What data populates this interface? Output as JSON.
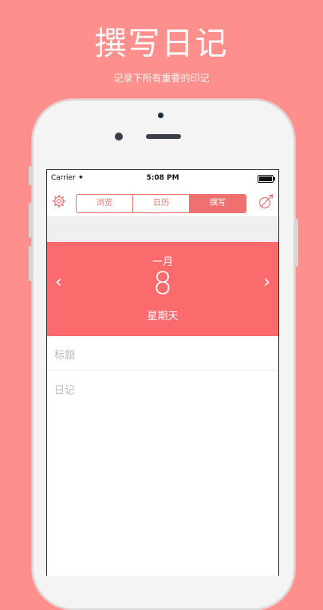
{
  "promo": {
    "title": "撰写日记",
    "subtitle": "记录下所有重要的印记"
  },
  "status_bar": {
    "carrier": "Carrier ✦",
    "time": "5:08 PM"
  },
  "nav": {
    "segments": [
      "浏览",
      "日历",
      "撰写"
    ],
    "active_segment": "撰写"
  },
  "date": {
    "month": "一月",
    "day": "8",
    "weekday": "星期天",
    "prev_arrow": "‹",
    "next_arrow": "›"
  },
  "fields": {
    "title_placeholder": "标题",
    "diary_placeholder": "日记"
  },
  "colors": {
    "background": "#fd8f8c",
    "accent": "#fb6b6d"
  }
}
